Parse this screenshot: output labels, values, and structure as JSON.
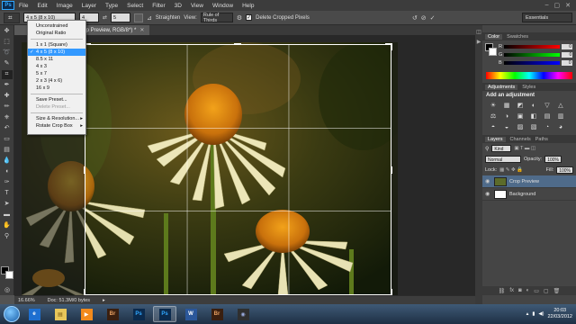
{
  "menubar": {
    "logo": "Ps",
    "items": [
      "File",
      "Edit",
      "Image",
      "Layer",
      "Type",
      "Select",
      "Filter",
      "3D",
      "View",
      "Window",
      "Help"
    ]
  },
  "options": {
    "ratio_value": "4 x 5 (8 x 10)",
    "width_value": "4",
    "height_value": "5",
    "straighten_label": "Straighten",
    "view_label": "View:",
    "view_value": "Rule of Thirds",
    "delete_cropped_label": "Delete Cropped Pixels",
    "workspace": "Essentials"
  },
  "document": {
    "tab_title": "Crop Preview, RGB/8*) *",
    "zoom": "16.66%",
    "doc_info": "Doc: 51.3M/0 bytes"
  },
  "ratio_menu": {
    "items": [
      {
        "label": "Unconstrained"
      },
      {
        "label": "Original Ratio"
      },
      {
        "sep": true
      },
      {
        "label": "1 x 1 (Square)"
      },
      {
        "label": "4 x 5 (8 x 10)",
        "selected": true
      },
      {
        "label": "8.5 x 11"
      },
      {
        "label": "4 x 3"
      },
      {
        "label": "5 x 7"
      },
      {
        "label": "2 x 3 (4 x 6)"
      },
      {
        "label": "16 x 9"
      },
      {
        "sep": true
      },
      {
        "label": "Save Preset..."
      },
      {
        "label": "Delete Preset...",
        "disabled": true
      },
      {
        "sep": true
      },
      {
        "label": "Size & Resolution...",
        "arrow": true
      },
      {
        "label": "Rotate Crop Box",
        "arrow": true
      }
    ]
  },
  "color_panel": {
    "tabs": [
      "Color",
      "Swatches"
    ],
    "sliders": [
      {
        "label": "R",
        "value": "0",
        "gradient": "linear-gradient(90deg,#000,#f00)"
      },
      {
        "label": "G",
        "value": "0",
        "gradient": "linear-gradient(90deg,#000,#0f0)"
      },
      {
        "label": "B",
        "value": "0",
        "gradient": "linear-gradient(90deg,#000,#00f)"
      }
    ]
  },
  "adjustments_panel": {
    "tabs": [
      "Adjustments",
      "Styles"
    ],
    "title": "Add an adjustment",
    "icons": [
      "☀",
      "▦",
      "◩",
      "◐",
      "▽",
      "△",
      "⚖",
      "◑",
      "▣",
      "◧",
      "▤",
      "▥",
      "◓",
      "◒",
      "▨",
      "▧",
      "◔",
      "◕"
    ]
  },
  "layers_panel": {
    "tabs": [
      "Layers",
      "Channels",
      "Paths"
    ],
    "kind_label": "Kind",
    "blend_mode": "Normal",
    "opacity_label": "Opacity:",
    "opacity_value": "100%",
    "lock_label": "Lock:",
    "fill_label": "Fill:",
    "fill_value": "100%",
    "layers": [
      {
        "name": "Crop Preview",
        "selected": true,
        "thumb": "#5c6b2a"
      },
      {
        "name": "Background",
        "selected": false,
        "thumb": "#ffffff"
      }
    ]
  },
  "taskbar": {
    "apps": [
      {
        "name": "internet-explorer",
        "glyph": "e",
        "bg": "#1e6fd0",
        "color": "#fff",
        "active": false
      },
      {
        "name": "file-explorer",
        "glyph": "▤",
        "bg": "#e8c65a",
        "color": "#7a5a10",
        "active": false
      },
      {
        "name": "media-player",
        "glyph": "▶",
        "bg": "#f28a1c",
        "color": "#fff",
        "active": false
      },
      {
        "name": "bridge",
        "glyph": "Br",
        "bg": "#3a1f0f",
        "color": "#e8a062",
        "active": false
      },
      {
        "name": "photoshop",
        "glyph": "Ps",
        "bg": "#0b2a4d",
        "color": "#31a8ff",
        "active": false
      },
      {
        "name": "photoshop-active",
        "glyph": "Ps",
        "bg": "#0b2a4d",
        "color": "#31a8ff",
        "active": true
      },
      {
        "name": "word",
        "glyph": "W",
        "bg": "#2b579a",
        "color": "#fff",
        "active": false
      },
      {
        "name": "bridge-2",
        "glyph": "Br",
        "bg": "#3a1f0f",
        "color": "#e8a062",
        "active": false
      },
      {
        "name": "other-app",
        "glyph": "◉",
        "bg": "#2f2f2f",
        "color": "#9ad",
        "active": false
      }
    ],
    "time": "20:03",
    "date": "22/03/2012"
  }
}
